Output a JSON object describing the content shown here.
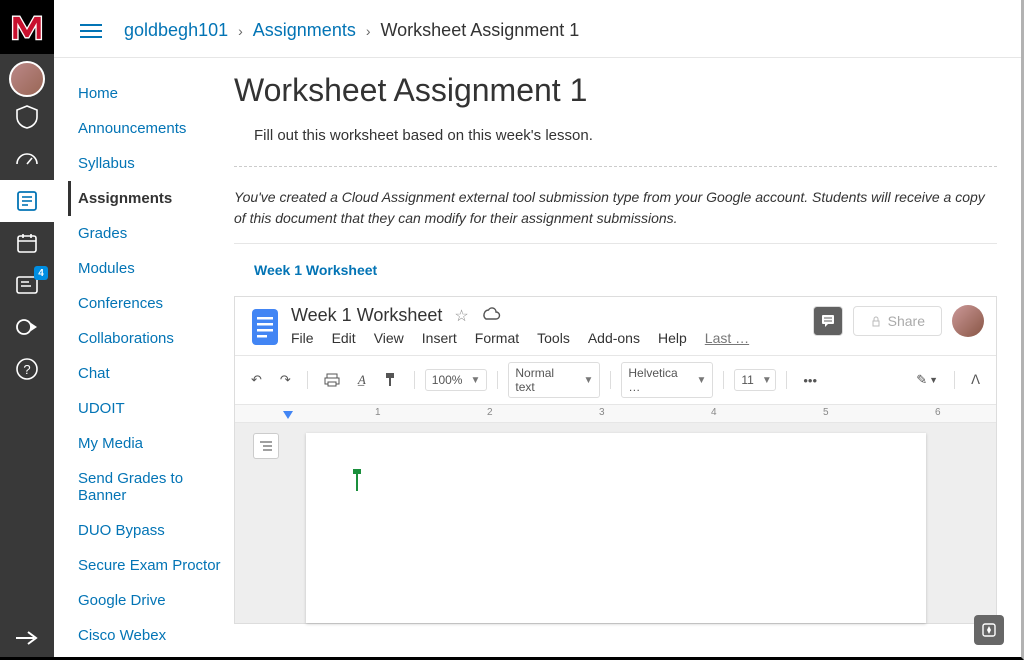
{
  "breadcrumb": {
    "course": "goldbegh101",
    "section": "Assignments",
    "page": "Worksheet Assignment 1"
  },
  "globalNav": {
    "badge": "4"
  },
  "courseNav": {
    "items": [
      "Home",
      "Announcements",
      "Syllabus",
      "Assignments",
      "Grades",
      "Modules",
      "Conferences",
      "Collaborations",
      "Chat",
      "UDOIT",
      "My Media",
      "Send Grades to Banner",
      "DUO Bypass",
      "Secure Exam Proctor",
      "Google Drive",
      "Cisco Webex"
    ],
    "activeIndex": 3
  },
  "assignment": {
    "title": "Worksheet Assignment 1",
    "description": "Fill out this worksheet based on this week's lesson.",
    "notice": "You've created a Cloud Assignment external tool submission type from your Google account. Students will receive a copy of this document that they can modify for their assignment submissions.",
    "docLink": "Week 1 Worksheet"
  },
  "doc": {
    "title": "Week 1 Worksheet",
    "menu": [
      "File",
      "Edit",
      "View",
      "Insert",
      "Format",
      "Tools",
      "Add-ons",
      "Help"
    ],
    "lastEdit": "Last …",
    "shareLabel": "Share",
    "zoom": "100%",
    "style": "Normal text",
    "font": "Helvetica …",
    "fontSize": "11",
    "rulerMarks": [
      "1",
      "2",
      "3",
      "4",
      "5",
      "6"
    ]
  }
}
